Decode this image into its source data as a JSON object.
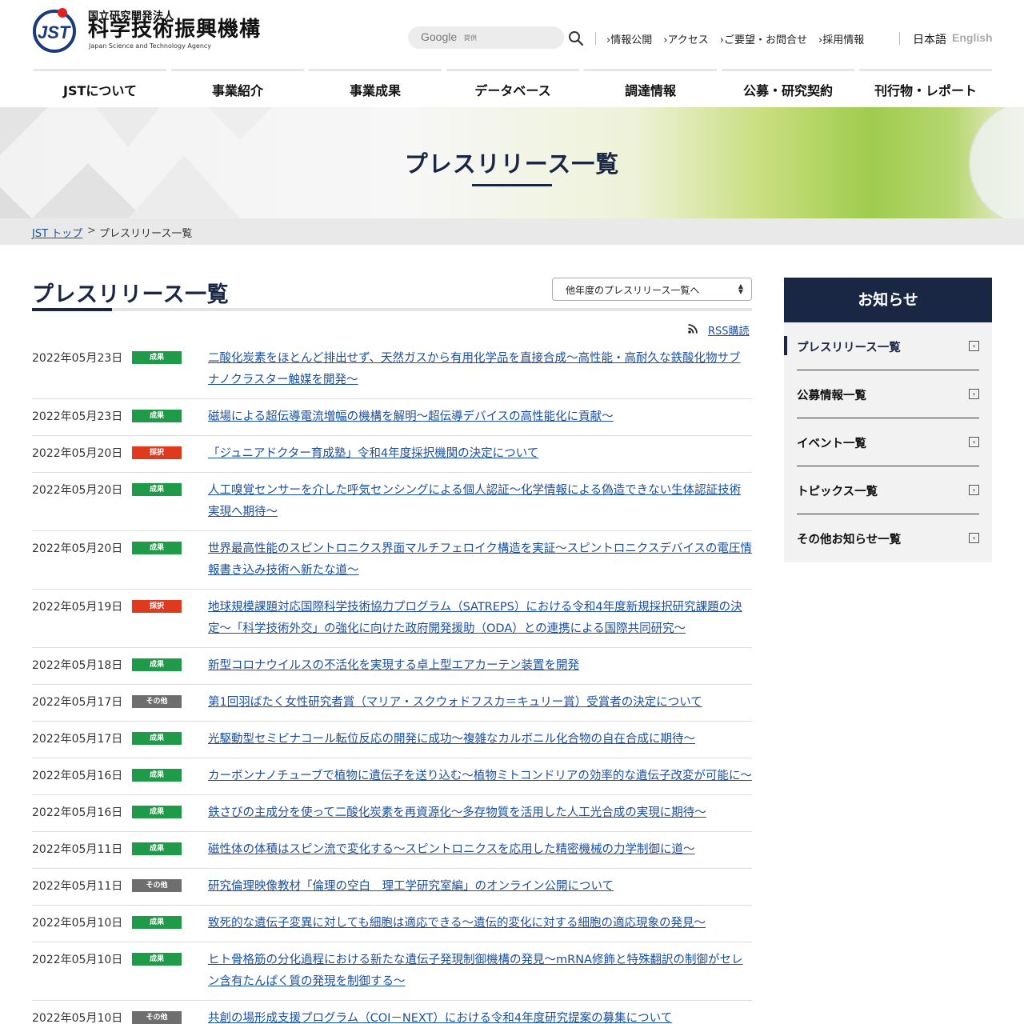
{
  "header": {
    "org_top": "国立研究開発法人",
    "org_name": "科学技術振興機構",
    "org_en": "Japan Science and Technology Agency",
    "logo_mark": "JST",
    "search_brand": "Google",
    "search_provided": "提供",
    "utility_links": [
      "情報公開",
      "アクセス",
      "ご要望・お問合せ",
      "採用情報"
    ],
    "lang_ja": "日本語",
    "lang_en": "English"
  },
  "nav": [
    "JSTについて",
    "事業紹介",
    "事業成果",
    "データベース",
    "調達情報",
    "公募・研究契約",
    "刊行物・レポート"
  ],
  "hero": {
    "title": "プレスリリース一覧"
  },
  "breadcrumb": {
    "home": "JST トップ",
    "separator": ">",
    "current": "プレスリリース一覧"
  },
  "main": {
    "title": "プレスリリース一覧",
    "year_select": "他年度のプレスリリース一覧へ",
    "rss": "RSS購読"
  },
  "releases": [
    {
      "date": "2022年05月23日",
      "badge": "成果",
      "kind": "result",
      "title": "二酸化炭素をほとんど排出せず、天然ガスから有用化学品を直接合成～高性能・高耐久な鉄酸化物サブナノクラスター触媒を開発～"
    },
    {
      "date": "2022年05月23日",
      "badge": "成果",
      "kind": "result",
      "title": "磁場による超伝導電流増幅の機構を解明～超伝導デバイスの高性能化に貢献～"
    },
    {
      "date": "2022年05月20日",
      "badge": "採択",
      "kind": "adopt",
      "title": "「ジュニアドクター育成塾」令和4年度採択機関の決定について"
    },
    {
      "date": "2022年05月20日",
      "badge": "成果",
      "kind": "result",
      "title": "人工嗅覚センサーを介した呼気センシングによる個人認証～化学情報による偽造できない生体認証技術実現へ期待～"
    },
    {
      "date": "2022年05月20日",
      "badge": "成果",
      "kind": "result",
      "title": "世界最高性能のスピントロニクス界面マルチフェロイク構造を実証～スピントロニクスデバイスの電圧情報書き込み技術へ新たな道～"
    },
    {
      "date": "2022年05月19日",
      "badge": "採択",
      "kind": "adopt",
      "title": "地球規模課題対応国際科学技術協力プログラム（SATREPS）における令和4年度新規採択研究課題の決定～「科学技術外交」の強化に向けた政府開発援助（ODA）との連携による国際共同研究～"
    },
    {
      "date": "2022年05月18日",
      "badge": "成果",
      "kind": "result",
      "title": "新型コロナウイルスの不活化を実現する卓上型エアカーテン装置を開発"
    },
    {
      "date": "2022年05月17日",
      "badge": "その他",
      "kind": "other",
      "title": "第1回羽ばたく女性研究者賞（マリア・スクウォドフスカ＝キュリー賞）受賞者の決定について"
    },
    {
      "date": "2022年05月17日",
      "badge": "成果",
      "kind": "result",
      "title": "光駆動型セミピナコール転位反応の開発に成功～複雑なカルボニル化合物の自在合成に期待～"
    },
    {
      "date": "2022年05月16日",
      "badge": "成果",
      "kind": "result",
      "title": "カーボンナノチューブで植物に遺伝子を送り込む～植物ミトコンドリアの効率的な遺伝子改変が可能に～"
    },
    {
      "date": "2022年05月16日",
      "badge": "成果",
      "kind": "result",
      "title": "鉄さびの主成分を使って二酸化炭素を再資源化～多存物質を活用した人工光合成の実現に期待～"
    },
    {
      "date": "2022年05月11日",
      "badge": "成果",
      "kind": "result",
      "title": "磁性体の体積はスピン流で変化する～スピントロニクスを応用した精密機械の力学制御に道～"
    },
    {
      "date": "2022年05月11日",
      "badge": "その他",
      "kind": "other",
      "title": "研究倫理映像教材「倫理の空白　理工学研究室編」のオンライン公開について"
    },
    {
      "date": "2022年05月10日",
      "badge": "成果",
      "kind": "result",
      "title": "致死的な遺伝子変異に対しても細胞は適応できる～遺伝的変化に対する細胞の適応現象の発見～"
    },
    {
      "date": "2022年05月10日",
      "badge": "成果",
      "kind": "result",
      "title": "ヒト骨格筋の分化過程における新たな遺伝子発現制御機構の発見～mRNA修飾と特殊翻訳の制御がセレン含有たんぱく質の発現を制御する～"
    },
    {
      "date": "2022年05月10日",
      "badge": "その他",
      "kind": "other",
      "title": "共創の場形成支援プログラム（COI－NEXT）における令和4年度研究提案の募集について"
    }
  ],
  "sidebar": {
    "title": "お知らせ",
    "items": [
      "プレスリリース一覧",
      "公募情報一覧",
      "イベント一覧",
      "トピックス一覧",
      "その他お知らせ一覧"
    ],
    "active_index": 0
  },
  "colors": {
    "navy": "#1a2744",
    "link": "#1b4f9c",
    "badge_result": "#1e9a48",
    "badge_adopt": "#e03a1e",
    "badge_other": "#6e6e6e"
  }
}
